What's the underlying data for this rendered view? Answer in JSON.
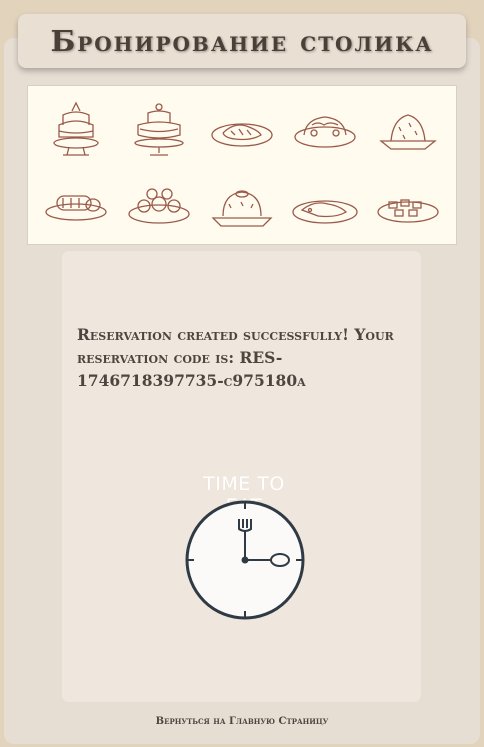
{
  "header": {
    "title": "Бронирование столика"
  },
  "banner": {
    "dishes": [
      "layered-cake-icon",
      "tiered-cake-icon",
      "fish-platter-icon",
      "roast-platter-icon",
      "pudding-icon",
      "stuffed-roll-icon",
      "appetizer-platter-icon",
      "ring-cake-icon",
      "fish-dish-icon",
      "canape-tray-icon"
    ],
    "ink_color": "#9a5a4a"
  },
  "confirmation": {
    "message": "Reservation created successfully! Your reservation code is: RES-1746718397735-c975180a"
  },
  "clock": {
    "label": "TIME TO EAT",
    "icon": "clock-fork-spoon-icon"
  },
  "footer": {
    "back_link": "Вернуться на Главную Страницу"
  }
}
